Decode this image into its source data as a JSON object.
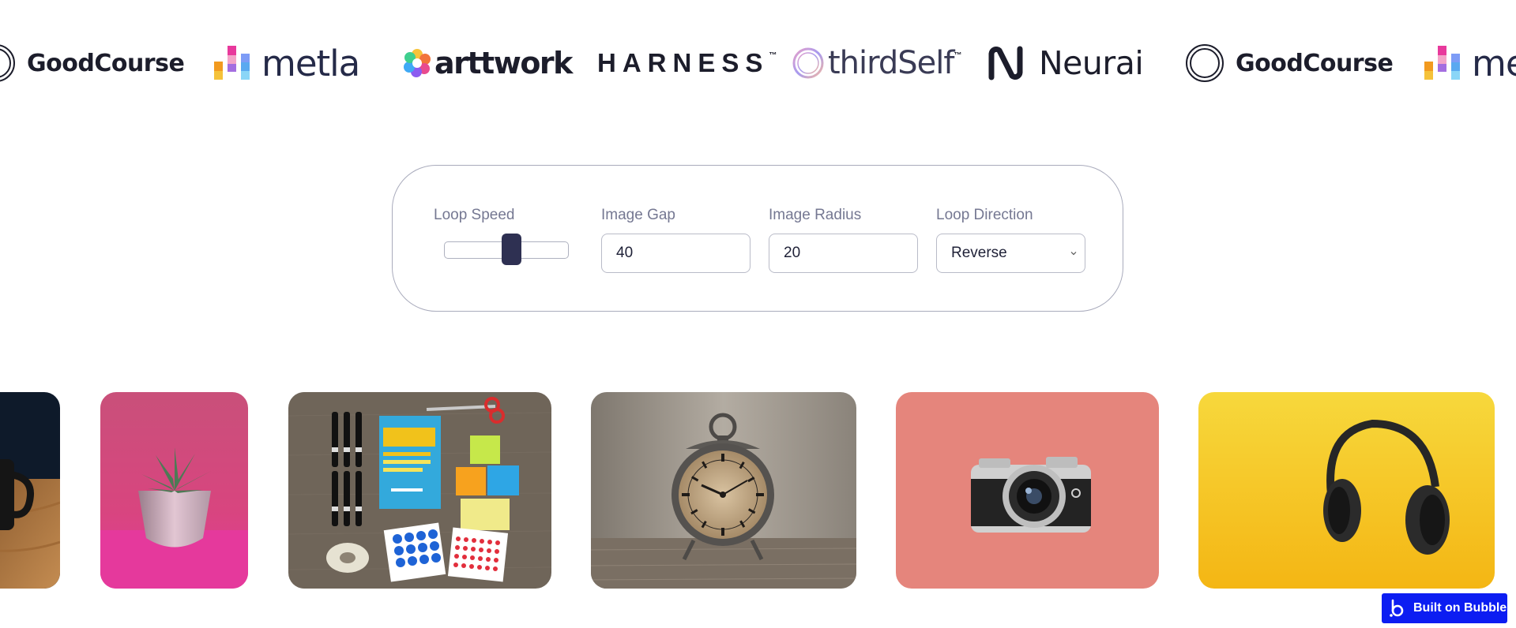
{
  "logos": [
    {
      "name": "GoodCourse",
      "text": "GoodCourse"
    },
    {
      "name": "metla",
      "text": "metla"
    },
    {
      "name": "arttwork",
      "text": "arttwork"
    },
    {
      "name": "HARNESS",
      "text": "HARNESS",
      "tm": "™"
    },
    {
      "name": "thirdSelf",
      "text": "thirdSelf",
      "tm": "™"
    },
    {
      "name": "Neurai",
      "text": "Neurai"
    },
    {
      "name": "GoodCourse",
      "text": "GoodCourse"
    },
    {
      "name": "metla",
      "text": "me"
    }
  ],
  "controls": {
    "loop_speed": {
      "label": "Loop Speed",
      "value": 0.55
    },
    "image_gap": {
      "label": "Image Gap",
      "value": "40"
    },
    "image_radius": {
      "label": "Image Radius",
      "value": "20"
    },
    "loop_direction": {
      "label": "Loop Direction",
      "value": "Reverse"
    }
  },
  "images": [
    {
      "subject": "coffee mug on wooden table"
    },
    {
      "subject": "succulent in pink pot"
    },
    {
      "subject": "Sprint book flatlay with pens, sticky notes, tape and scissors"
    },
    {
      "subject": "vintage alarm clock"
    },
    {
      "subject": "mirrorless camera on pink background"
    },
    {
      "subject": "headphones on yellow background"
    }
  ],
  "badge": {
    "label": "Built on Bubble"
  },
  "colors": {
    "accent": "#2e3052",
    "panel_border": "#a9abbc",
    "label_gray": "#757892",
    "badge_blue": "#0c1df2"
  }
}
